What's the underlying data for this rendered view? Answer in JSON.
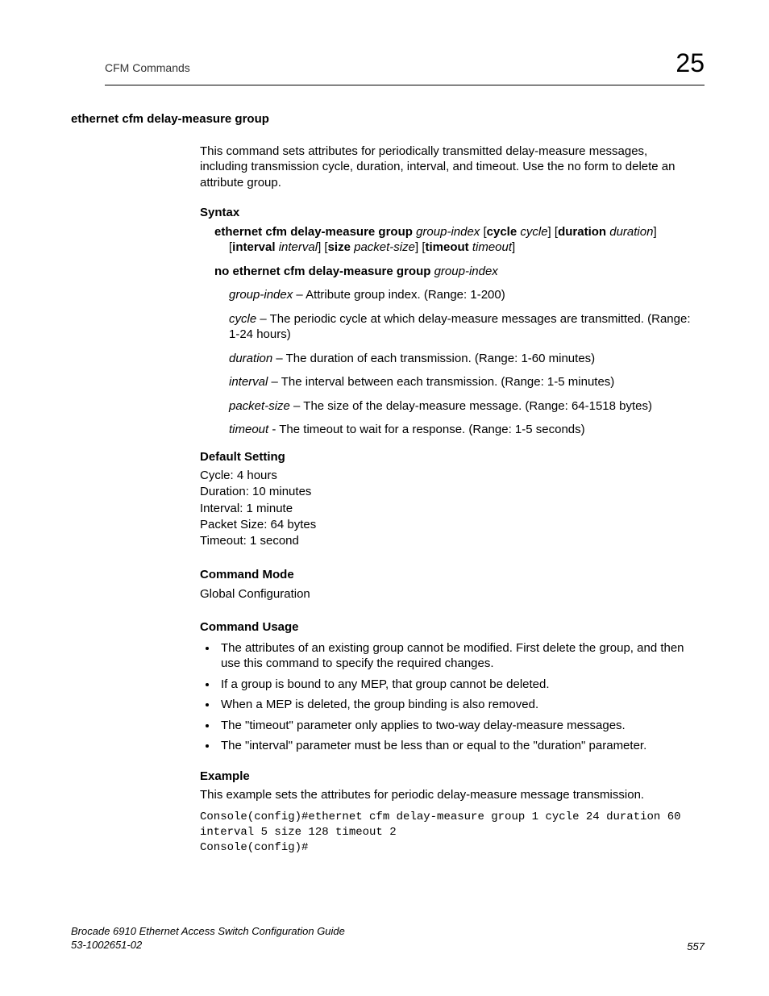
{
  "header": {
    "left": "CFM Commands",
    "chapter": "25"
  },
  "title": "ethernet cfm delay-measure group",
  "intro": "This command sets attributes for periodically transmitted delay-measure messages, including transmission cycle, duration, interval, and timeout. Use the no form to delete an attribute group.",
  "syntax": {
    "heading": "Syntax",
    "line1_b1": "ethernet cfm delay-measure group ",
    "line1_i1": "group-index",
    "line1_t1": " [",
    "line1_b2": "cycle",
    "line1_t2": " ",
    "line1_i2": "cycle",
    "line1_t3": "] [",
    "line1_b3": "duration",
    "line1_t4": " ",
    "line1_i3": "duration",
    "line1_t5": "]",
    "line2_t1": "[",
    "line2_b1": "interval",
    "line2_t2": " ",
    "line2_i1": "interval",
    "line2_t3": "] [",
    "line2_b2": "size",
    "line2_t4": " ",
    "line2_i2": "packet-size",
    "line2_t5": "] [",
    "line2_b3": "timeout",
    "line2_t6": " ",
    "line2_i3": "timeout",
    "line2_t7": "]",
    "no_b": "no ethernet cfm delay-measure group ",
    "no_i": "group-index"
  },
  "params": {
    "p1_i": "group-index",
    "p1_t": " – Attribute group index. (Range: 1-200)",
    "p2_i": "cycle",
    "p2_t": " – The periodic cycle at which delay-measure messages are transmitted. (Range: 1-24 hours)",
    "p3_i": "duration",
    "p3_t": " – The duration of each transmission. (Range: 1-60 minutes)",
    "p4_i": "interval",
    "p4_t": " – The interval between each transmission. (Range: 1-5 minutes)",
    "p5_i": "packet-size",
    "p5_t": " – The size of the delay-measure message. (Range: 64-1518 bytes)",
    "p6_i": "timeout",
    "p6_t": " - The timeout to wait for a response. (Range: 1-5 seconds)"
  },
  "default": {
    "heading": "Default Setting",
    "l1": "Cycle: 4 hours",
    "l2": "Duration: 10 minutes",
    "l3": "Interval: 1 minute",
    "l4": "Packet Size: 64 bytes",
    "l5": "Timeout: 1 second"
  },
  "mode": {
    "heading": "Command Mode",
    "text": "Global Configuration"
  },
  "usage": {
    "heading": "Command Usage",
    "u1": "The attributes of an existing group cannot be modified. First delete the group, and then use this command to specify the required changes.",
    "u2": "If a group is bound to any MEP, that group cannot be deleted.",
    "u3": "When a MEP is deleted, the group binding is also removed.",
    "u4": "The \"timeout\" parameter only applies to two-way delay-measure messages.",
    "u5": "The \"interval\" parameter must be less than or equal to the \"duration\" parameter."
  },
  "example": {
    "heading": "Example",
    "desc": "This example sets the attributes for periodic delay-measure message transmission.",
    "code": "Console(config)#ethernet cfm delay-measure group 1 cycle 24 duration 60 interval 5 size 128 timeout 2\nConsole(config)#"
  },
  "footer": {
    "book": "Brocade 6910 Ethernet Access Switch Configuration Guide",
    "docnum": "53-1002651-02",
    "page": "557"
  }
}
